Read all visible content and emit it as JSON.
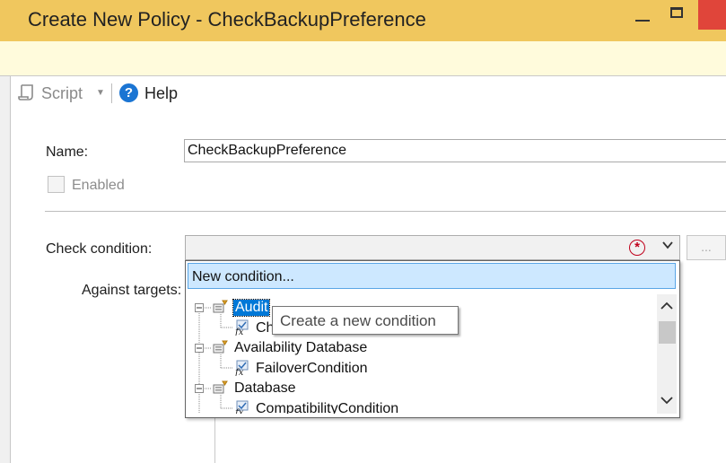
{
  "window": {
    "title": "Create New Policy - CheckBackupPreference",
    "controls": [
      "minimize-icon",
      "maximize-icon",
      "close-icon"
    ]
  },
  "toolbar": {
    "script_label": "Script",
    "help_label": "Help",
    "script_icon": "script-icon",
    "help_icon": "help-icon",
    "help_glyph": "?",
    "dropdown_glyph": "▼"
  },
  "form": {
    "name_label": "Name:",
    "name_value": "CheckBackupPreference",
    "enabled_label": "Enabled",
    "enabled_checked": false,
    "check_condition_label": "Check condition:",
    "against_targets_label": "Against targets:",
    "error_glyph": "*",
    "ellipsis_label": "..."
  },
  "dropdown": {
    "new_condition": "New condition...",
    "tree": [
      {
        "category": "Audit",
        "selected": true,
        "children": [
          "Ch"
        ]
      },
      {
        "category": "Availability Database",
        "selected": false,
        "children": [
          "FailoverCondition"
        ]
      },
      {
        "category": "Database",
        "selected": false,
        "children": [
          "CompatibilityCondition"
        ]
      }
    ]
  },
  "tooltip": {
    "text": "Create a new condition"
  },
  "colors": {
    "titlebar": "#f0c75e",
    "infobar": "#fffbdc",
    "selection": "#0078d7",
    "highlight": "#cde8ff",
    "close": "#e0453a",
    "error": "#c0001b",
    "help_blue": "#1b75d3"
  }
}
